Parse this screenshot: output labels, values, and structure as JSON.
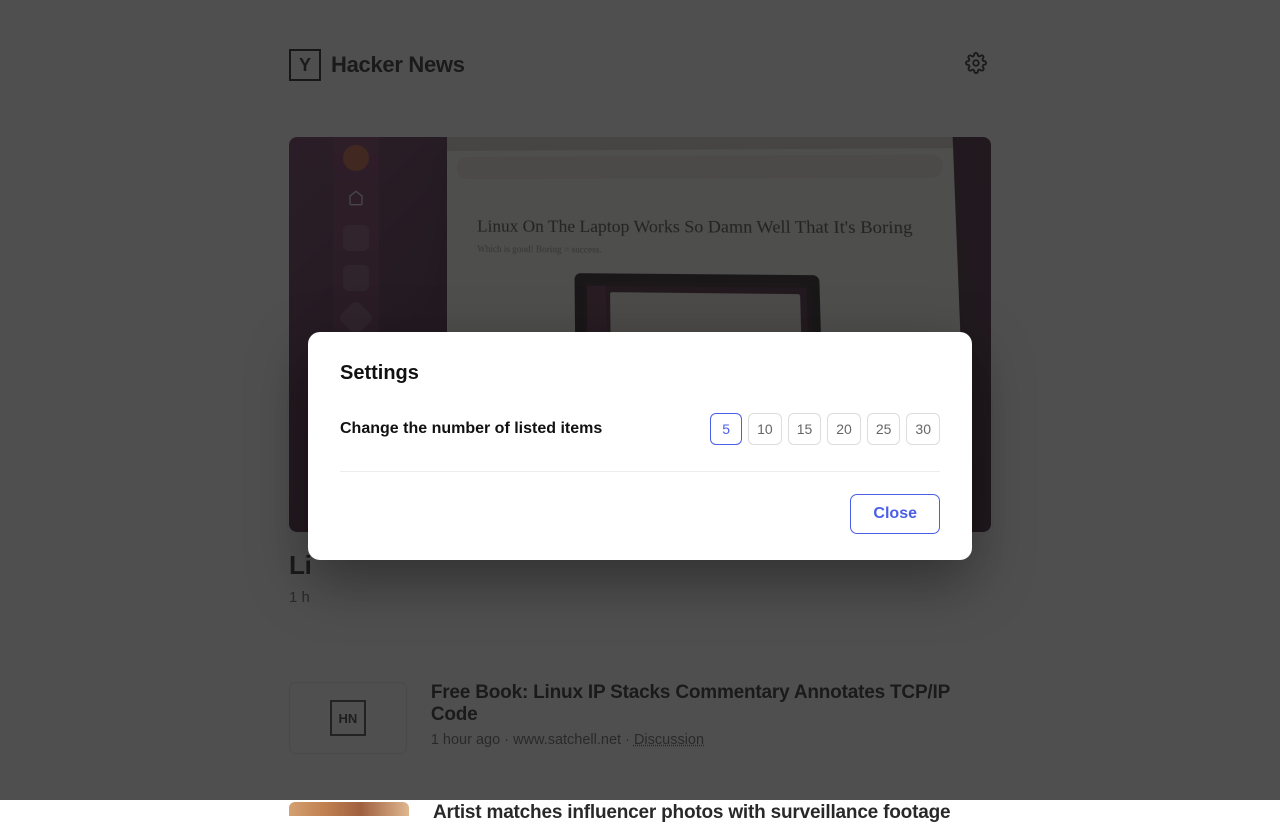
{
  "header": {
    "logo_letter": "Y",
    "title": "Hacker News"
  },
  "hero_image": {
    "article_headline": "Linux On The Laptop Works So Damn Well That It's Boring",
    "article_sub": "Which is good! Boring = success."
  },
  "posts": [
    {
      "title_visible": "Li",
      "meta_visible": "1 h"
    },
    {
      "title": "Free Book: Linux IP Stacks Commentary Annotates TCP/IP Code",
      "time_ago": "1 hour ago",
      "domain": "www.satchell.net",
      "discussion_label": "Discussion",
      "thumb_label": "HN"
    },
    {
      "title_visible": "Artist matches influencer photos with surveillance footage"
    }
  ],
  "modal": {
    "title": "Settings",
    "setting_label": "Change the number of listed items",
    "options": [
      "5",
      "10",
      "15",
      "20",
      "25",
      "30"
    ],
    "selected": "5",
    "close_label": "Close"
  },
  "meta_separator": " · "
}
